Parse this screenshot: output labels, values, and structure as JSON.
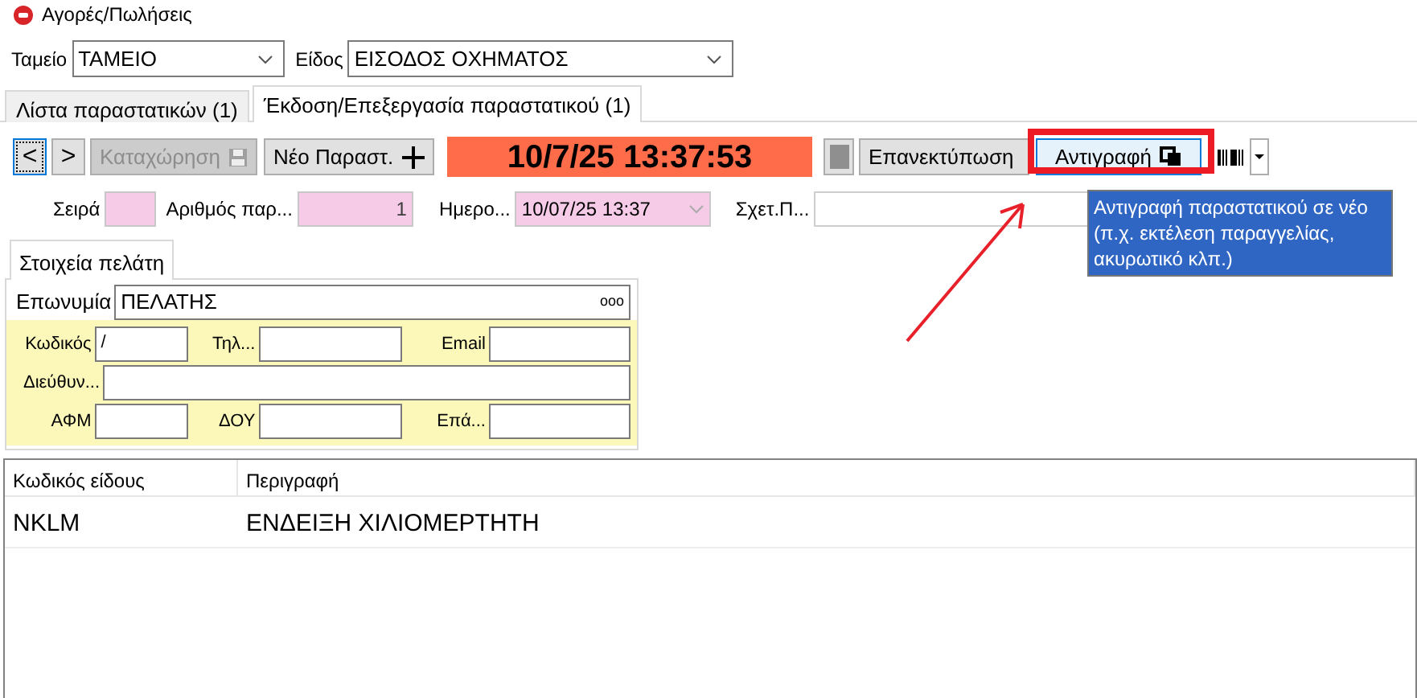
{
  "window": {
    "title": "Αγορές/Πωλήσεις"
  },
  "filters": [
    {
      "label": "Ταμείο",
      "value": "ΤΑΜΕΙΟ"
    },
    {
      "label": "Είδος",
      "value": "ΕΙΣΟΔΟΣ ΟΧΗΜΑΤΟΣ"
    }
  ],
  "tabs": [
    {
      "label": "Λίστα παραστατικών (1)",
      "selected": false
    },
    {
      "label": "Έκδοση/Επεξεργασία παραστατικού (1)",
      "selected": true
    }
  ],
  "toolbar": {
    "back": {
      "symbol": "<",
      "focused": true
    },
    "forward": {
      "symbol": ">",
      "focused": false
    },
    "save": {
      "label": "Καταχώρηση",
      "disabled": true
    },
    "new": {
      "label": "Νέο Παραστ.",
      "disabled": false
    },
    "clock": "10/7/25 13:37:53",
    "reprint": {
      "label": "Επανεκτύπωση"
    },
    "copy": {
      "label": "Αντιγραφή",
      "hovered": true,
      "highlighted": true
    },
    "tooltip": "Αντιγραφή παραστατικού σε νέο (π.χ. εκτέλεση παραγγελίας, ακυρωτικό κλπ.)"
  },
  "header_fields": [
    {
      "label": "Σειρά",
      "required": true
    },
    {
      "label": "Αριθμός παρ...",
      "value": "1",
      "required": true
    },
    {
      "label": "Ημερο...",
      "value": "10/07/25 13:37",
      "required": true
    },
    {
      "label": "Σχετ.Π...",
      "required": false
    }
  ],
  "customer": {
    "tab": "Στοιχεία πελάτη",
    "name_label": "Επωνυμία",
    "name_value": "ΠΕΛΑΤΗΣ",
    "more": "ooo",
    "fields": [
      {
        "label": "Κωδικός",
        "value": "/"
      },
      {
        "label": "Τηλ..."
      },
      {
        "label": "Email"
      },
      {
        "label": "Διεύθυν..."
      },
      {
        "label": "ΑΦΜ"
      },
      {
        "label": "ΔΟΥ"
      },
      {
        "label": "Επά..."
      }
    ]
  },
  "table": {
    "columns": [
      "Κωδικός είδους",
      "Περιγραφή"
    ],
    "rows": [
      [
        "NKLM",
        "ΕΝΔΕΙΞΗ ΧΙΛΙΟΜΕΡΤΗΤΗ"
      ]
    ]
  },
  "callout_arrow": true
}
